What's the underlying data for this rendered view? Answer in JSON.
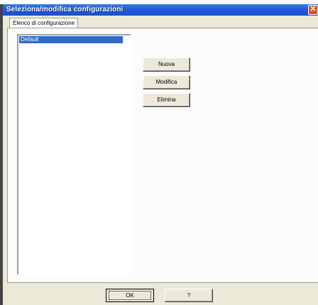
{
  "window": {
    "title": "Seleziona/modifica configurazioni",
    "close_glyph": "✕",
    "close_icon": "close-icon"
  },
  "tabs": [
    {
      "label": "Elenco di configurazione",
      "selected": true
    }
  ],
  "configurations": {
    "items": [
      "Default"
    ],
    "selected": "Default"
  },
  "actions": {
    "new_label": "Nuova",
    "edit_label": "Modifica",
    "delete_label": "Elimina"
  },
  "footer": {
    "ok_label": "OK",
    "help_label": "?"
  },
  "colors": {
    "titlebar": "#245edb",
    "selection": "#316ac5",
    "dialog_bg": "#ece9d8"
  }
}
